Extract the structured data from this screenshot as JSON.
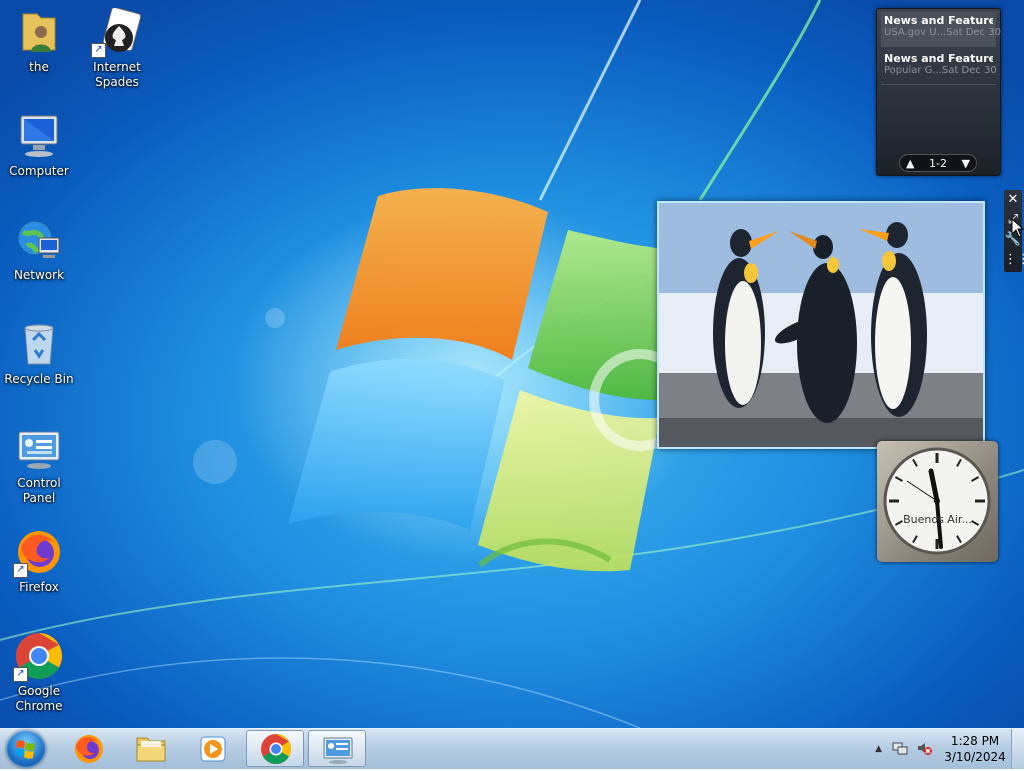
{
  "desktop_icons": [
    {
      "label": "the",
      "icon": "user-folder-icon"
    },
    {
      "label": "Internet Spades",
      "icon": "spades-game-icon",
      "shortcut": true
    },
    {
      "label": "Computer",
      "icon": "computer-icon"
    },
    {
      "label": "Network",
      "icon": "network-icon"
    },
    {
      "label": "Recycle Bin",
      "icon": "recycle-bin-icon"
    },
    {
      "label": "Control Panel",
      "icon": "control-panel-icon"
    },
    {
      "label": "Firefox",
      "icon": "firefox-icon",
      "shortcut": true
    },
    {
      "label": "Google Chrome",
      "icon": "chrome-icon",
      "shortcut": true
    }
  ],
  "feed_gadget": {
    "items": [
      {
        "title": "News and Features f...",
        "source": "USA.gov U...",
        "date": "Sat Dec 30"
      },
      {
        "title": "News and Features f...",
        "source": "Popular G...",
        "date": "Sat Dec 30"
      }
    ],
    "pager": "1-2",
    "up_icon": "arrow-up-icon",
    "down_icon": "arrow-down-icon"
  },
  "slideshow_gadget": {
    "image": "penguins-photo"
  },
  "gadget_tools": {
    "close_icon": "close-icon",
    "size_icon": "larger-size-icon",
    "options_icon": "wrench-icon",
    "drag_icon": "drag-grip-icon"
  },
  "clock_gadget": {
    "city": "Buenos Air...",
    "time": "1:28"
  },
  "taskbar": {
    "pinned": [
      {
        "name": "firefox",
        "icon": "firefox-icon",
        "active": false
      },
      {
        "name": "explorer",
        "icon": "folder-icon",
        "active": false
      },
      {
        "name": "media-player",
        "icon": "media-player-icon",
        "active": false
      },
      {
        "name": "chrome",
        "icon": "chrome-icon",
        "active": true
      },
      {
        "name": "control-panel",
        "icon": "control-panel-icon",
        "active": true
      }
    ],
    "tray": {
      "show_hidden": "▲",
      "time": "1:28 PM",
      "date": "3/10/2024"
    }
  },
  "colors": {
    "wallpaper": "#1f8fe0",
    "taskbar": "#b6cde3",
    "feed_bg": "#2a3038"
  }
}
